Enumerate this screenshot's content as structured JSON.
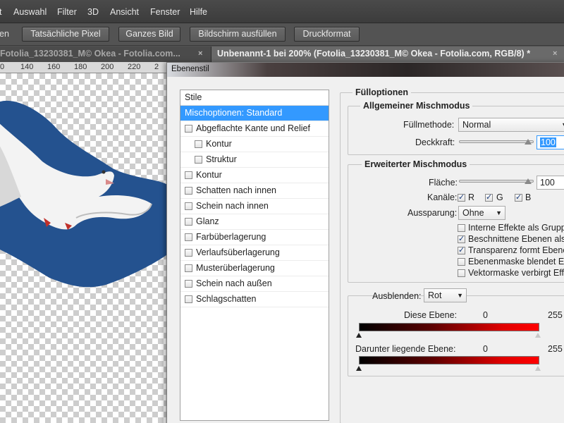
{
  "menubar": {
    "items": [
      "t",
      "Auswahl",
      "Filter",
      "3D",
      "Ansicht",
      "Fenster",
      "Hilfe"
    ]
  },
  "optionsbar": {
    "label": "en",
    "buttons": [
      "Tatsächliche Pixel",
      "Ganzes Bild",
      "Bildschirm ausfüllen",
      "Druckformat"
    ]
  },
  "tabs": [
    {
      "label": "Fotolia_13230381_M© Okea - Fotolia.com...",
      "close": "×"
    },
    {
      "label": "Unbenannt-1 bei 200% (Fotolia_13230381_M© Okea - Fotolia.com, RGB/8) *",
      "close": "×"
    }
  ],
  "ruler": {
    "ticks": [
      "0",
      "140",
      "160",
      "180",
      "200",
      "220",
      "2"
    ]
  },
  "dialog": {
    "title": "Ebenenstil",
    "styles_header": "Stile",
    "styles": [
      {
        "label": "Mischoptionen: Standard",
        "selected": true,
        "checkbox": false,
        "indent": false
      },
      {
        "label": "Abgeflachte Kante und Relief",
        "checkbox": true,
        "checked": false,
        "indent": false
      },
      {
        "label": "Kontur",
        "checkbox": true,
        "checked": false,
        "indent": true
      },
      {
        "label": "Struktur",
        "checkbox": true,
        "checked": false,
        "indent": true
      },
      {
        "label": "Kontur",
        "checkbox": true,
        "checked": false,
        "indent": false
      },
      {
        "label": "Schatten nach innen",
        "checkbox": true,
        "checked": false,
        "indent": false
      },
      {
        "label": "Schein nach innen",
        "checkbox": true,
        "checked": false,
        "indent": false
      },
      {
        "label": "Glanz",
        "checkbox": true,
        "checked": false,
        "indent": false
      },
      {
        "label": "Farbüberlagerung",
        "checkbox": true,
        "checked": false,
        "indent": false
      },
      {
        "label": "Verlaufsüberlagerung",
        "checkbox": true,
        "checked": false,
        "indent": false
      },
      {
        "label": "Musterüberlagerung",
        "checkbox": true,
        "checked": false,
        "indent": false
      },
      {
        "label": "Schein nach außen",
        "checkbox": true,
        "checked": false,
        "indent": false
      },
      {
        "label": "Schlagschatten",
        "checkbox": true,
        "checked": false,
        "indent": false
      }
    ],
    "fill_options": {
      "title": "Fülloptionen",
      "general": {
        "title": "Allgemeiner Mischmodus",
        "blend_label": "Füllmethode:",
        "blend_value": "Normal",
        "opacity_label": "Deckkraft:",
        "opacity_value": "100"
      },
      "advanced": {
        "title": "Erweiterter Mischmodus",
        "fill_label": "Fläche:",
        "fill_value": "100",
        "channels_label": "Kanäle:",
        "channels": [
          {
            "label": "R",
            "checked": true
          },
          {
            "label": "G",
            "checked": true
          },
          {
            "label": "B",
            "checked": true
          }
        ],
        "knockout_label": "Aussparung:",
        "knockout_value": "Ohne",
        "options": [
          {
            "label": "Interne Effekte als Grupp",
            "checked": false
          },
          {
            "label": "Beschnittene Ebenen als",
            "checked": true
          },
          {
            "label": "Transparenz formt Ebene",
            "checked": true
          },
          {
            "label": "Ebenenmaske blendet Ef",
            "checked": false
          },
          {
            "label": "Vektormaske verbirgt Eff",
            "checked": false
          }
        ]
      },
      "blend_if": {
        "label": "Ausblenden:",
        "value": "Rot",
        "this_layer_label": "Diese Ebene:",
        "this_min": "0",
        "this_max": "255",
        "underlying_label": "Darunter liegende Ebene:",
        "under_min": "0",
        "under_max": "255"
      }
    }
  }
}
